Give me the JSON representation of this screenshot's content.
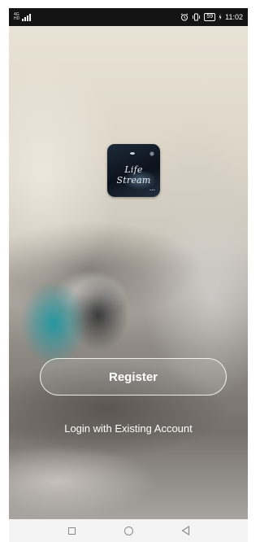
{
  "status_bar": {
    "network_type_top": "4G",
    "network_type_bottom": "HD",
    "battery": "59",
    "time": "11:02",
    "icons": [
      "signal-icon",
      "alarm-icon",
      "vibrate-icon",
      "battery-icon"
    ]
  },
  "app_logo": {
    "text": "Life Stream"
  },
  "actions": {
    "register_label": "Register",
    "login_label": "Login with Existing Account"
  },
  "nav_bar": {
    "icons": [
      "recents-square-icon",
      "home-circle-icon",
      "back-triangle-icon"
    ]
  },
  "colors": {
    "status_bar_bg": "#141414",
    "button_border": "#ffffff",
    "text": "#ffffff",
    "nav_bar_bg": "#f4f4f4"
  }
}
